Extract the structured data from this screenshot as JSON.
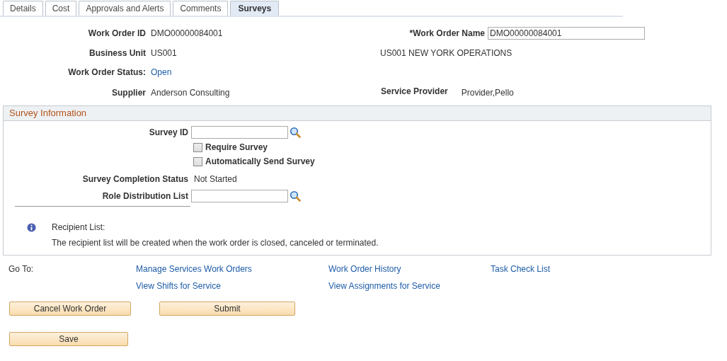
{
  "tabs": [
    {
      "label": "Details",
      "selected": false
    },
    {
      "label": "Cost",
      "selected": false
    },
    {
      "label": "Approvals and Alerts",
      "selected": false
    },
    {
      "label": "Comments",
      "selected": false
    },
    {
      "label": "Surveys",
      "selected": true
    }
  ],
  "header": {
    "work_order_id": {
      "label": "Work Order ID",
      "value": "DMO00000084001"
    },
    "work_order_name": {
      "label": "*Work Order Name",
      "value": "DMO00000084001"
    },
    "business_unit": {
      "label": "Business Unit",
      "value": "US001",
      "description": "US001 NEW YORK OPERATIONS"
    },
    "work_order_status": {
      "label": "Work Order Status:",
      "value": "Open"
    },
    "supplier": {
      "label": "Supplier",
      "value": "Anderson Consulting"
    },
    "service_provider": {
      "label": "Service Provider",
      "value": "Provider,Pello"
    }
  },
  "survey_information": {
    "title": "Survey Information",
    "survey_id": {
      "label": "Survey ID"
    },
    "checkboxes": [
      {
        "label": "Require Survey",
        "checked": false
      },
      {
        "label": "Automatically Send Survey",
        "checked": false
      }
    ],
    "completion_status": {
      "label": "Survey Completion Status",
      "value": "Not Started"
    },
    "role_distribution_list": {
      "label": "Role Distribution List"
    },
    "recipient_list": {
      "title": "Recipient List:",
      "text": "The recipient list will be created when the work order is closed, canceled or terminated."
    }
  },
  "go_to": {
    "label": "Go To:",
    "links": [
      [
        "Manage Services Work Orders",
        "View Shifts for Service"
      ],
      [
        "Work Order History",
        "View Assignments for Service"
      ],
      [
        "Task Check List"
      ]
    ]
  },
  "buttons": [
    [
      "Cancel Work Order",
      "Submit"
    ],
    [
      "Save"
    ]
  ]
}
